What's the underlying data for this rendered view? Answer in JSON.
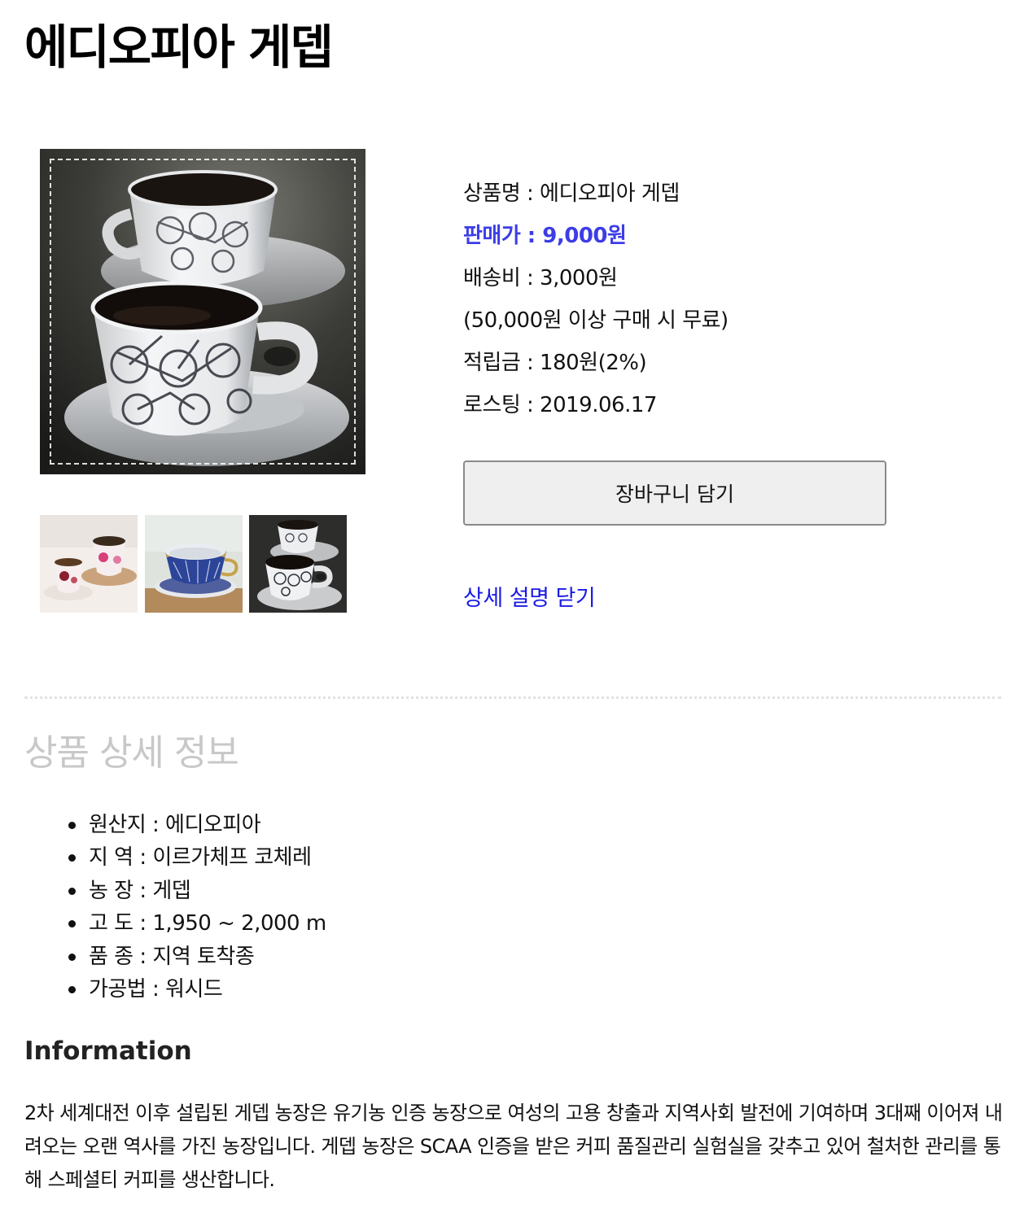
{
  "page": {
    "title": "에디오피아 게뎁"
  },
  "product": {
    "main_image_alt": "bicycle-pattern-coffee-cups",
    "thumbnails": [
      {
        "icon": "pink-floral-cups-photo"
      },
      {
        "icon": "blue-gold-cup-photo"
      },
      {
        "icon": "bicycle-pattern-cups-photo"
      }
    ],
    "name_line": "상품명 : 에디오피아 게뎁",
    "price_line": "판매가 : 9,000원",
    "shipping_line": "배송비 : 3,000원",
    "free_shipping_line": "(50,000원 이상 구매 시 무료)",
    "points_line": "적립금 : 180원(2%)",
    "roasting_line": "로스팅 : 2019.06.17",
    "cart_button_label": "장바구니 담기",
    "detail_toggle_label": "상세 설명 닫기",
    "price_color": "#3d3de8",
    "link_color": "#1a1ae6"
  },
  "details": {
    "section_title": "상품 상세 정보",
    "specs": [
      "원산지 : 에디오피아",
      "지 역 : 이르가체프 코체레",
      "농 장 : 게뎁",
      "고 도 : 1,950 ~ 2,000 m",
      "품 종 : 지역 토착종",
      "가공법 : 워시드"
    ],
    "info_heading": "Information",
    "info_text": "2차 세계대전 이후 설립된 게뎁 농장은 유기농 인증 농장으로 여성의 고용 창출과 지역사회 발전에 기여하며 3대째 이어져 내려오는 오랜 역사를 가진 농장입니다. 게뎁 농장은 SCAA 인증을 받은 커피 품질관리 실험실을 갖추고 있어 철처한 관리를 통해 스페셜티 커피를 생산합니다."
  }
}
